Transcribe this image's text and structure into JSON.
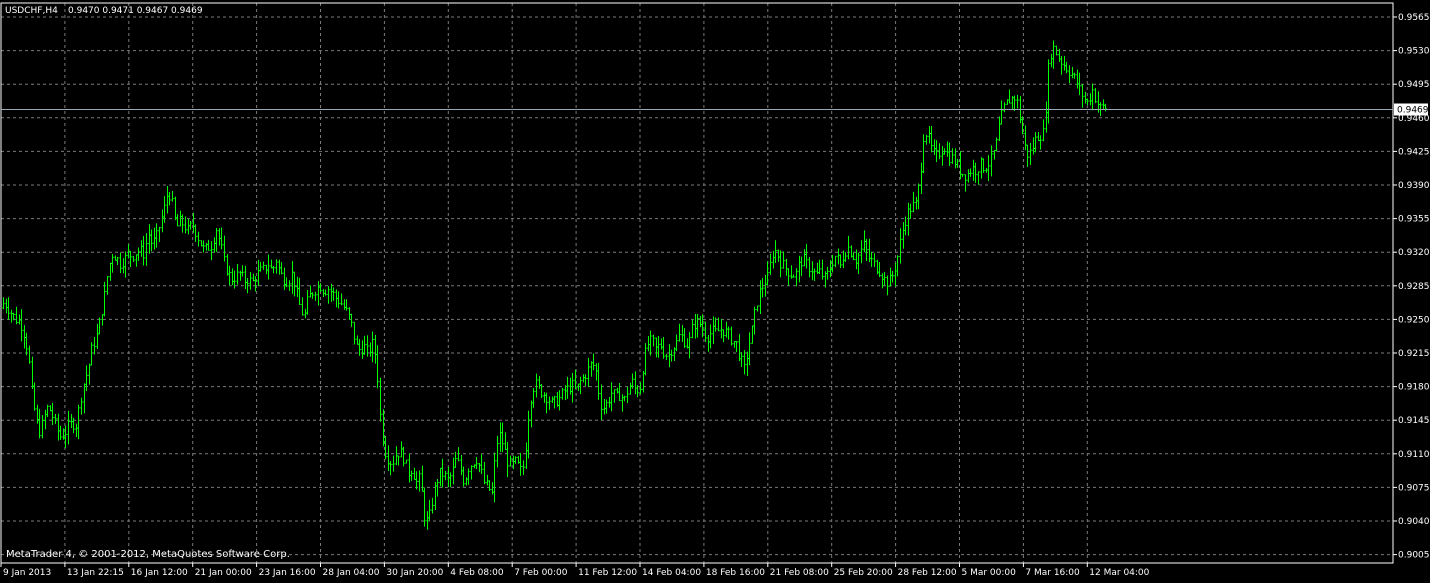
{
  "header": {
    "symbol": "USDCHF,H4",
    "quote": "0.9470 0.9471 0.9467 0.9469"
  },
  "footer": {
    "copyright": "MetaTrader 4, © 2001-2012, MetaQuotes Software Corp."
  },
  "colors": {
    "background": "#000000",
    "grid": "#7a7a7a",
    "axis": "#ffffff",
    "bars": "#00ff00",
    "price_line": "#9aa9b3",
    "price_label_bg": "#ffffff",
    "price_label_text": "#000000"
  },
  "chart_data": {
    "type": "ohlc-bar",
    "title": "",
    "ylim": [
      0.9005,
      0.9582
    ],
    "y_ticks": [
      "0.9565",
      "0.9530",
      "0.9495",
      "0.9460",
      "0.9425",
      "0.9390",
      "0.9355",
      "0.9320",
      "0.9285",
      "0.9250",
      "0.9215",
      "0.9180",
      "0.9145",
      "0.9110",
      "0.9075",
      "0.9040",
      "0.9005"
    ],
    "x_ticks": [
      "9 Jan 2013",
      "13 Jan 22:15",
      "16 Jan 12:00",
      "21 Jan 00:00",
      "23 Jan 16:00",
      "28 Jan 04:00",
      "30 Jan 20:00",
      "4 Feb 08:00",
      "7 Feb 00:00",
      "11 Feb 12:00",
      "14 Feb 04:00",
      "18 Feb 16:00",
      "21 Feb 08:00",
      "25 Feb 20:00",
      "28 Feb 12:00",
      "5 Mar 00:00",
      "7 Mar 16:00",
      "12 Mar 04:00"
    ],
    "current_price": "0.9469",
    "grid": true,
    "closes_by_tick": [
      0.9265,
      0.9142,
      0.9318,
      0.933,
      0.929,
      0.9275,
      0.911,
      0.9085,
      0.9105,
      0.917,
      0.923,
      0.9215,
      0.931,
      0.9295,
      0.936,
      0.941,
      0.9425,
      0.9469
    ],
    "close_path": [
      [
        0,
        0.9262
      ],
      [
        4,
        0.9268
      ],
      [
        8,
        0.9262
      ],
      [
        12,
        0.9255
      ],
      [
        16,
        0.925
      ],
      [
        20,
        0.9248
      ],
      [
        24,
        0.9235
      ],
      [
        28,
        0.9215
      ],
      [
        32,
        0.917
      ],
      [
        36,
        0.9145
      ],
      [
        40,
        0.9132
      ],
      [
        44,
        0.9148
      ],
      [
        48,
        0.916
      ],
      [
        52,
        0.915
      ],
      [
        56,
        0.9138
      ],
      [
        60,
        0.9128
      ],
      [
        64,
        0.913
      ],
      [
        68,
        0.9138
      ],
      [
        72,
        0.9142
      ],
      [
        76,
        0.914
      ],
      [
        80,
        0.9165
      ],
      [
        84,
        0.9185
      ],
      [
        88,
        0.9198
      ],
      [
        92,
        0.9222
      ],
      [
        96,
        0.923
      ],
      [
        100,
        0.925
      ],
      [
        104,
        0.9272
      ],
      [
        108,
        0.9302
      ],
      [
        112,
        0.9318
      ],
      [
        116,
        0.9315
      ],
      [
        120,
        0.9308
      ],
      [
        124,
        0.9312
      ],
      [
        128,
        0.9318
      ],
      [
        132,
        0.9316
      ],
      [
        136,
        0.932
      ],
      [
        140,
        0.9322
      ],
      [
        144,
        0.9318
      ],
      [
        148,
        0.934
      ],
      [
        152,
        0.9328
      ],
      [
        156,
        0.9335
      ],
      [
        160,
        0.935
      ],
      [
        164,
        0.9365
      ],
      [
        168,
        0.9385
      ],
      [
        172,
        0.937
      ],
      [
        176,
        0.9345
      ],
      [
        180,
        0.9352
      ],
      [
        184,
        0.9348
      ],
      [
        188,
        0.9342
      ],
      [
        192,
        0.935
      ],
      [
        196,
        0.934
      ],
      [
        200,
        0.933
      ],
      [
        204,
        0.9322
      ],
      [
        208,
        0.9325
      ],
      [
        212,
        0.9328
      ],
      [
        216,
        0.9345
      ],
      [
        220,
        0.933
      ],
      [
        224,
        0.931
      ],
      [
        228,
        0.9298
      ],
      [
        232,
        0.9292
      ],
      [
        236,
        0.9295
      ],
      [
        240,
        0.9298
      ],
      [
        244,
        0.929
      ],
      [
        248,
        0.9292
      ],
      [
        252,
        0.9288
      ],
      [
        256,
        0.9296
      ],
      [
        260,
        0.93
      ],
      [
        264,
        0.9302
      ],
      [
        268,
        0.9308
      ],
      [
        272,
        0.93
      ],
      [
        276,
        0.9312
      ],
      [
        280,
        0.9298
      ],
      [
        284,
        0.9292
      ],
      [
        288,
        0.929
      ],
      [
        292,
        0.9298
      ],
      [
        296,
        0.928
      ],
      [
        300,
        0.9262
      ],
      [
        304,
        0.9252
      ],
      [
        308,
        0.9272
      ],
      [
        312,
        0.9278
      ],
      [
        316,
        0.9282
      ],
      [
        320,
        0.9285
      ],
      [
        324,
        0.928
      ],
      [
        328,
        0.9282
      ],
      [
        332,
        0.9278
      ],
      [
        336,
        0.9272
      ],
      [
        340,
        0.9268
      ],
      [
        344,
        0.9262
      ],
      [
        348,
        0.9255
      ],
      [
        352,
        0.9242
      ],
      [
        356,
        0.9222
      ],
      [
        360,
        0.9218
      ],
      [
        364,
        0.9222
      ],
      [
        368,
        0.9215
      ],
      [
        372,
        0.9225
      ],
      [
        376,
        0.921
      ],
      [
        380,
        0.915
      ],
      [
        384,
        0.9115
      ],
      [
        388,
        0.9105
      ],
      [
        392,
        0.91
      ],
      [
        396,
        0.911
      ],
      [
        400,
        0.9112
      ],
      [
        404,
        0.9105
      ],
      [
        408,
        0.909
      ],
      [
        412,
        0.9095
      ],
      [
        416,
        0.908
      ],
      [
        420,
        0.9085
      ],
      [
        424,
        0.9045
      ],
      [
        428,
        0.9038
      ],
      [
        432,
        0.906
      ],
      [
        436,
        0.908
      ],
      [
        440,
        0.909
      ],
      [
        444,
        0.9088
      ],
      [
        448,
        0.9082
      ],
      [
        452,
        0.909
      ],
      [
        456,
        0.9105
      ],
      [
        460,
        0.9095
      ],
      [
        464,
        0.908
      ],
      [
        468,
        0.9095
      ],
      [
        472,
        0.91
      ],
      [
        476,
        0.9105
      ],
      [
        480,
        0.9095
      ],
      [
        484,
        0.908
      ],
      [
        488,
        0.9075
      ],
      [
        492,
        0.9068
      ],
      [
        496,
        0.912
      ],
      [
        500,
        0.913
      ],
      [
        504,
        0.9115
      ],
      [
        508,
        0.91
      ],
      [
        512,
        0.9098
      ],
      [
        516,
        0.9102
      ],
      [
        520,
        0.9092
      ],
      [
        524,
        0.9098
      ],
      [
        528,
        0.9148
      ],
      [
        532,
        0.9178
      ],
      [
        536,
        0.9182
      ],
      [
        540,
        0.9176
      ],
      [
        544,
        0.9172
      ],
      [
        548,
        0.9168
      ],
      [
        552,
        0.9162
      ],
      [
        556,
        0.9165
      ],
      [
        560,
        0.9168
      ],
      [
        564,
        0.9175
      ],
      [
        568,
        0.9178
      ],
      [
        572,
        0.9182
      ],
      [
        576,
        0.9176
      ],
      [
        580,
        0.9185
      ],
      [
        584,
        0.919
      ],
      [
        588,
        0.9198
      ],
      [
        592,
        0.9205
      ],
      [
        596,
        0.9195
      ],
      [
        600,
        0.9162
      ],
      [
        604,
        0.9158
      ],
      [
        608,
        0.9165
      ],
      [
        612,
        0.9175
      ],
      [
        616,
        0.9168
      ],
      [
        620,
        0.9172
      ],
      [
        624,
        0.9165
      ],
      [
        628,
        0.9178
      ],
      [
        632,
        0.9185
      ],
      [
        636,
        0.9175
      ],
      [
        640,
        0.918
      ],
      [
        644,
        0.921
      ],
      [
        648,
        0.9225
      ],
      [
        652,
        0.9228
      ],
      [
        656,
        0.9218
      ],
      [
        660,
        0.9225
      ],
      [
        664,
        0.9215
      ],
      [
        668,
        0.9212
      ],
      [
        672,
        0.922
      ],
      [
        676,
        0.9225
      ],
      [
        680,
        0.9235
      ],
      [
        684,
        0.9228
      ],
      [
        688,
        0.9222
      ],
      [
        692,
        0.924
      ],
      [
        696,
        0.9248
      ],
      [
        700,
        0.9245
      ],
      [
        704,
        0.9236
      ],
      [
        708,
        0.9232
      ],
      [
        712,
        0.9238
      ],
      [
        716,
        0.9236
      ],
      [
        720,
        0.924
      ],
      [
        724,
        0.9238
      ],
      [
        728,
        0.9235
      ],
      [
        732,
        0.9228
      ],
      [
        736,
        0.9225
      ],
      [
        740,
        0.921
      ],
      [
        744,
        0.9198
      ],
      [
        748,
        0.922
      ],
      [
        752,
        0.924
      ],
      [
        756,
        0.9265
      ],
      [
        760,
        0.928
      ],
      [
        764,
        0.9288
      ],
      [
        768,
        0.9295
      ],
      [
        772,
        0.9318
      ],
      [
        776,
        0.9322
      ],
      [
        780,
        0.931
      ],
      [
        784,
        0.9305
      ],
      [
        788,
        0.93
      ],
      [
        792,
        0.9296
      ],
      [
        796,
        0.9298
      ],
      [
        800,
        0.931
      ],
      [
        804,
        0.9312
      ],
      [
        808,
        0.9305
      ],
      [
        812,
        0.9302
      ],
      [
        816,
        0.9296
      ],
      [
        820,
        0.93
      ],
      [
        824,
        0.9292
      ],
      [
        828,
        0.9298
      ],
      [
        832,
        0.931
      ],
      [
        836,
        0.9318
      ],
      [
        840,
        0.9305
      ],
      [
        844,
        0.932
      ],
      [
        848,
        0.9325
      ],
      [
        852,
        0.9318
      ],
      [
        856,
        0.9312
      ],
      [
        860,
        0.932
      ],
      [
        864,
        0.9328
      ],
      [
        868,
        0.9315
      ],
      [
        872,
        0.931
      ],
      [
        876,
        0.9305
      ],
      [
        880,
        0.93
      ],
      [
        884,
        0.9292
      ],
      [
        888,
        0.9288
      ],
      [
        892,
        0.9295
      ],
      [
        896,
        0.9308
      ],
      [
        900,
        0.933
      ],
      [
        904,
        0.935
      ],
      [
        908,
        0.9362
      ],
      [
        912,
        0.9368
      ],
      [
        916,
        0.937
      ],
      [
        920,
        0.94
      ],
      [
        924,
        0.9448
      ],
      [
        928,
        0.944
      ],
      [
        932,
        0.9425
      ],
      [
        936,
        0.942
      ],
      [
        940,
        0.9425
      ],
      [
        944,
        0.943
      ],
      [
        948,
        0.942
      ],
      [
        952,
        0.9418
      ],
      [
        956,
        0.9412
      ],
      [
        960,
        0.9405
      ],
      [
        964,
        0.94
      ],
      [
        968,
        0.9402
      ],
      [
        972,
        0.9408
      ],
      [
        976,
        0.9405
      ],
      [
        980,
        0.9412
      ],
      [
        984,
        0.9408
      ],
      [
        988,
        0.9412
      ],
      [
        992,
        0.9418
      ],
      [
        996,
        0.9432
      ],
      [
        1000,
        0.9458
      ],
      [
        1004,
        0.947
      ],
      [
        1008,
        0.9478
      ],
      [
        1012,
        0.948
      ],
      [
        1016,
        0.9482
      ],
      [
        1020,
        0.9458
      ],
      [
        1024,
        0.9432
      ],
      [
        1028,
        0.942
      ],
      [
        1032,
        0.9428
      ],
      [
        1036,
        0.944
      ],
      [
        1040,
        0.9442
      ],
      [
        1044,
        0.9445
      ],
      [
        1048,
        0.951
      ],
      [
        1052,
        0.9535
      ],
      [
        1056,
        0.9528
      ],
      [
        1060,
        0.952
      ],
      [
        1064,
        0.9515
      ],
      [
        1068,
        0.951
      ],
      [
        1072,
        0.9505
      ],
      [
        1076,
        0.9498
      ],
      [
        1080,
        0.9488
      ],
      [
        1084,
        0.948
      ],
      [
        1088,
        0.9475
      ],
      [
        1092,
        0.949
      ],
      [
        1096,
        0.9478
      ],
      [
        1100,
        0.947
      ],
      [
        1104,
        0.9472
      ],
      [
        1108,
        0.9469
      ]
    ]
  }
}
